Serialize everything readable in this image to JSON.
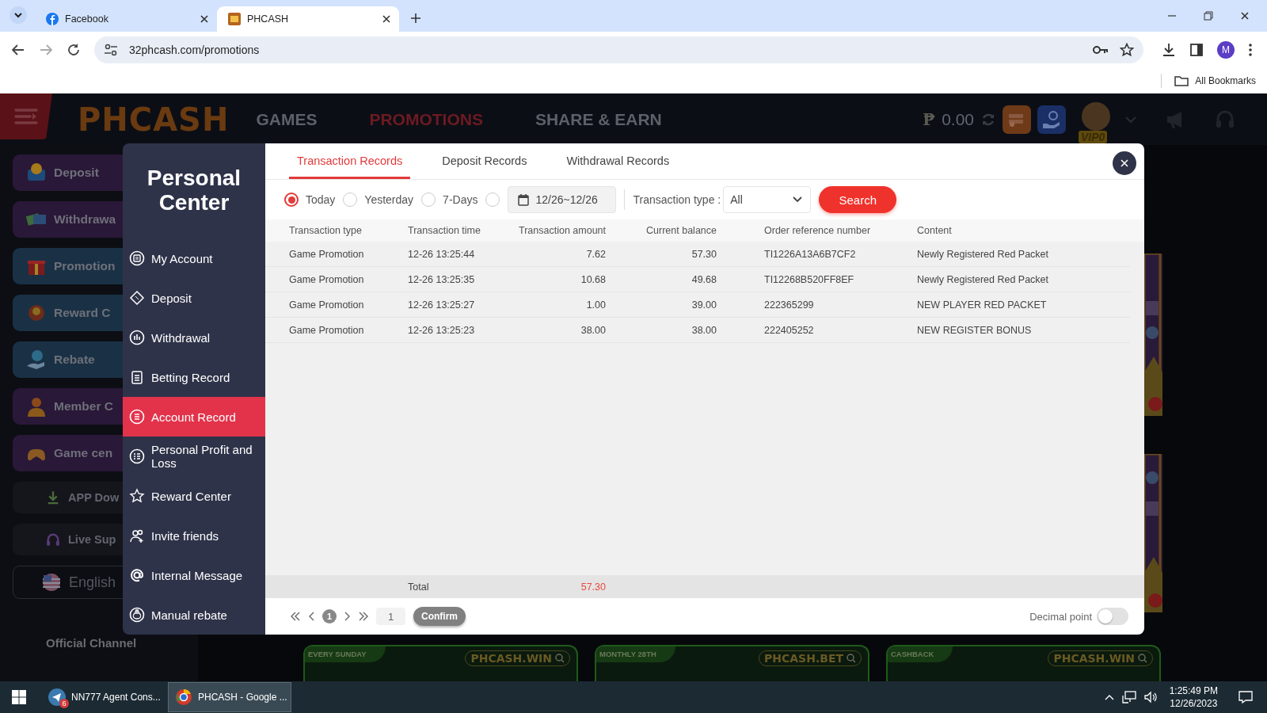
{
  "browser": {
    "tabs": [
      {
        "label": "Facebook",
        "selected": false
      },
      {
        "label": "PHCASH",
        "selected": true
      }
    ],
    "url": "32phcash.com/promotions",
    "profile_initial": "M",
    "bookmarks": "All Bookmarks"
  },
  "site": {
    "logo": "PHCASH",
    "nav": [
      {
        "label": "GAMES",
        "selected": false
      },
      {
        "label": "PROMOTIONS",
        "selected": true
      },
      {
        "label": "SHARE & EARN",
        "selected": false
      }
    ],
    "currency": "₱",
    "balance": "0.00",
    "vip": "VIP0",
    "sidebar": [
      {
        "label": "Deposit",
        "kind": "purple"
      },
      {
        "label": "Withdrawa",
        "kind": "purple"
      },
      {
        "label": "Promotion",
        "kind": "blue"
      },
      {
        "label": "Reward C",
        "kind": "blue"
      },
      {
        "label": "Rebate",
        "kind": "blue"
      },
      {
        "label": "Member C",
        "kind": "purple"
      },
      {
        "label": "Game cen",
        "kind": "purple"
      },
      {
        "label": "APP Dow",
        "kind": "plain"
      },
      {
        "label": "Live Sup",
        "kind": "plain"
      },
      {
        "label": "English",
        "kind": "language"
      }
    ],
    "channel_heading": "Official Channel",
    "promo_cards": [
      {
        "tag": "EVERY SUNDAY",
        "domain": "PHCASH.WIN"
      },
      {
        "tag": "MONTHLY 28TH",
        "domain": "PHCASH.BET"
      },
      {
        "tag": "CASHBACK",
        "domain": "PHCASH.WIN"
      }
    ]
  },
  "modal": {
    "title": "Personal Center",
    "menu": [
      {
        "label": "My Account",
        "selected": false
      },
      {
        "label": "Deposit",
        "selected": false
      },
      {
        "label": "Withdrawal",
        "selected": false
      },
      {
        "label": "Betting Record",
        "selected": false
      },
      {
        "label": "Account Record",
        "selected": true
      },
      {
        "label": "Personal Profit and Loss",
        "selected": false
      },
      {
        "label": "Reward Center",
        "selected": false
      },
      {
        "label": "Invite friends",
        "selected": false
      },
      {
        "label": "Internal Message",
        "selected": false
      },
      {
        "label": "Manual rebate",
        "selected": false
      }
    ],
    "tabs": [
      {
        "label": "Transaction Records",
        "selected": true
      },
      {
        "label": "Deposit Records",
        "selected": false
      },
      {
        "label": "Withdrawal Records",
        "selected": false
      }
    ],
    "periods": [
      {
        "label": "Today",
        "selected": true
      },
      {
        "label": "Yesterday",
        "selected": false
      },
      {
        "label": "7-Days",
        "selected": false
      }
    ],
    "date_range": {
      "selected": false,
      "value": "12/26~12/26"
    },
    "type_label": "Transaction type :",
    "type_value": "All",
    "search_button": "Search",
    "table": {
      "columns": [
        "Transaction type",
        "Transaction time",
        "Transaction amount",
        "Current balance",
        "Order reference number",
        "Content"
      ],
      "rows": [
        [
          "Game Promotion",
          "12-26 13:25:44",
          "7.62",
          "57.30",
          "TI1226A13A6B7CF2",
          "Newly Registered Red Packet"
        ],
        [
          "Game Promotion",
          "12-26 13:25:35",
          "10.68",
          "49.68",
          "TI12268B520FF8EF",
          "Newly Registered Red Packet"
        ],
        [
          "Game Promotion",
          "12-26 13:25:27",
          "1.00",
          "39.00",
          "222365299",
          "NEW PLAYER RED PACKET"
        ],
        [
          "Game Promotion",
          "12-26 13:25:23",
          "38.00",
          "38.00",
          "222405252",
          "NEW REGISTER BONUS"
        ]
      ]
    },
    "total_label": "Total",
    "total_value": "57.30",
    "pager": {
      "current_page": "1",
      "page_input": "1",
      "confirm_button": "Confirm"
    },
    "decimal_point": {
      "label": "Decimal point",
      "on": false
    }
  },
  "taskbar": {
    "apps": [
      {
        "label": "NN777 Agent Cons...",
        "badge": "6",
        "selected": false
      },
      {
        "label": "PHCASH - Google ...",
        "selected": true
      }
    ],
    "time": "1:25:49 PM",
    "date": "12/26/2023"
  }
}
